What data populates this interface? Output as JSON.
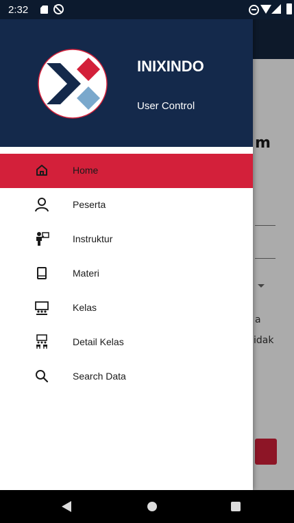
{
  "status_bar": {
    "time": "2:32",
    "icons": [
      "sd-card-icon",
      "sync-icon",
      "do-not-disturb-icon",
      "wifi-icon",
      "signal-icon",
      "battery-icon"
    ]
  },
  "background_screen": {
    "heading_fragment": "m",
    "text_fragment_1": "a",
    "text_fragment_2": "idak"
  },
  "drawer": {
    "header": {
      "brand": "INIXINDO",
      "subtitle": "User Control"
    },
    "items": [
      {
        "label": "Home",
        "icon": "home-icon",
        "active": true
      },
      {
        "label": "Peserta",
        "icon": "person-icon",
        "active": false
      },
      {
        "label": "Instruktur",
        "icon": "instructor-icon",
        "active": false
      },
      {
        "label": "Materi",
        "icon": "book-icon",
        "active": false
      },
      {
        "label": "Kelas",
        "icon": "classroom-icon",
        "active": false
      },
      {
        "label": "Detail Kelas",
        "icon": "class-detail-icon",
        "active": false
      },
      {
        "label": "Search Data",
        "icon": "search-icon",
        "active": false
      }
    ]
  },
  "nav_bar": {
    "buttons": [
      "back-icon",
      "home-circle-icon",
      "recents-icon"
    ]
  },
  "colors": {
    "header_bg": "#14294b",
    "active_item": "#d3203a",
    "logo_red": "#d3203a",
    "logo_blue": "#7aa8cc",
    "logo_navy": "#14294b"
  }
}
